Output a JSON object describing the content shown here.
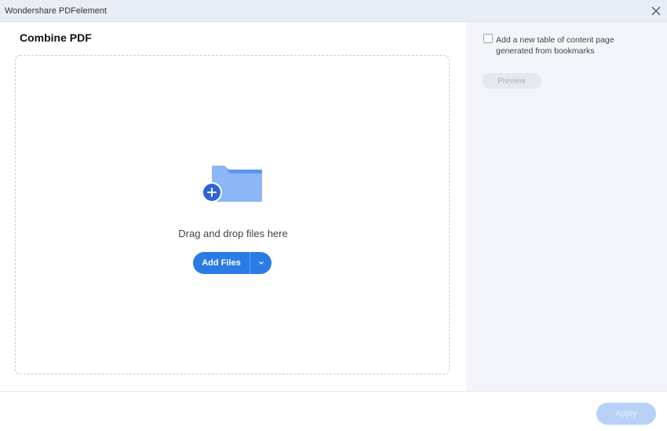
{
  "window": {
    "title": "Wondershare PDFelement",
    "close_icon": "close-icon"
  },
  "main": {
    "heading": "Combine PDF",
    "dropzone": {
      "icon": "add-folder-icon",
      "text": "Drag and drop files here",
      "add_files_label": "Add Files",
      "dropdown_icon": "chevron-down-icon"
    }
  },
  "side": {
    "toc_checkbox_checked": false,
    "toc_label": "Add a new table of content page generated from bookmarks",
    "preview_label": "Preview"
  },
  "footer": {
    "apply_label": "Apply"
  },
  "colors": {
    "accent": "#2a7be4",
    "folder": "#8bb6f7",
    "folder_tab": "#5d95ef",
    "sidebar_bg": "#f3f5fa",
    "titlebar_bg": "#e9edf5"
  }
}
